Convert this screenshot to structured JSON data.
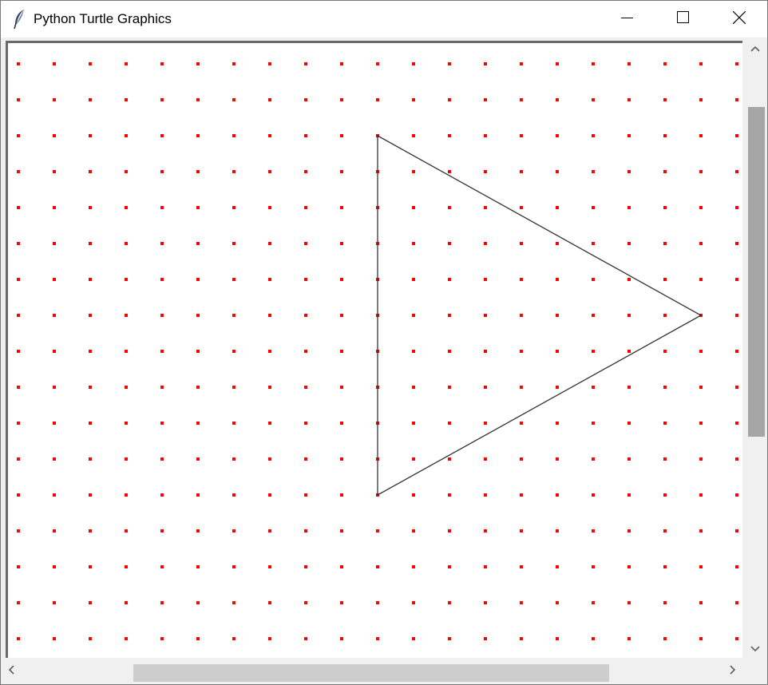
{
  "window": {
    "title": "Python Turtle Graphics",
    "app_icon": "feather-icon",
    "controls": {
      "minimize_icon": "minimize-icon",
      "maximize_icon": "maximize-icon",
      "close_icon": "close-icon"
    }
  },
  "canvas": {
    "background": "#ffffff",
    "dot_color": "#ff0000",
    "line_color": "#333333",
    "dot_grid": {
      "columns": 21,
      "rows": 17
    },
    "triangle": {
      "vertices_grid": [
        [
          10,
          2
        ],
        [
          10,
          12
        ],
        [
          19,
          7
        ]
      ],
      "stroke": "#333333"
    }
  },
  "scrollbars": {
    "vertical": {
      "up_icon": "chevron-up-icon",
      "down_icon": "chevron-down-icon",
      "thumb_position": 0.11,
      "thumb_fraction": 0.54
    },
    "horizontal": {
      "left_icon": "chevron-left-icon",
      "right_icon": "chevron-right-icon",
      "thumb_position": 0.18,
      "thumb_fraction": 0.67
    }
  }
}
